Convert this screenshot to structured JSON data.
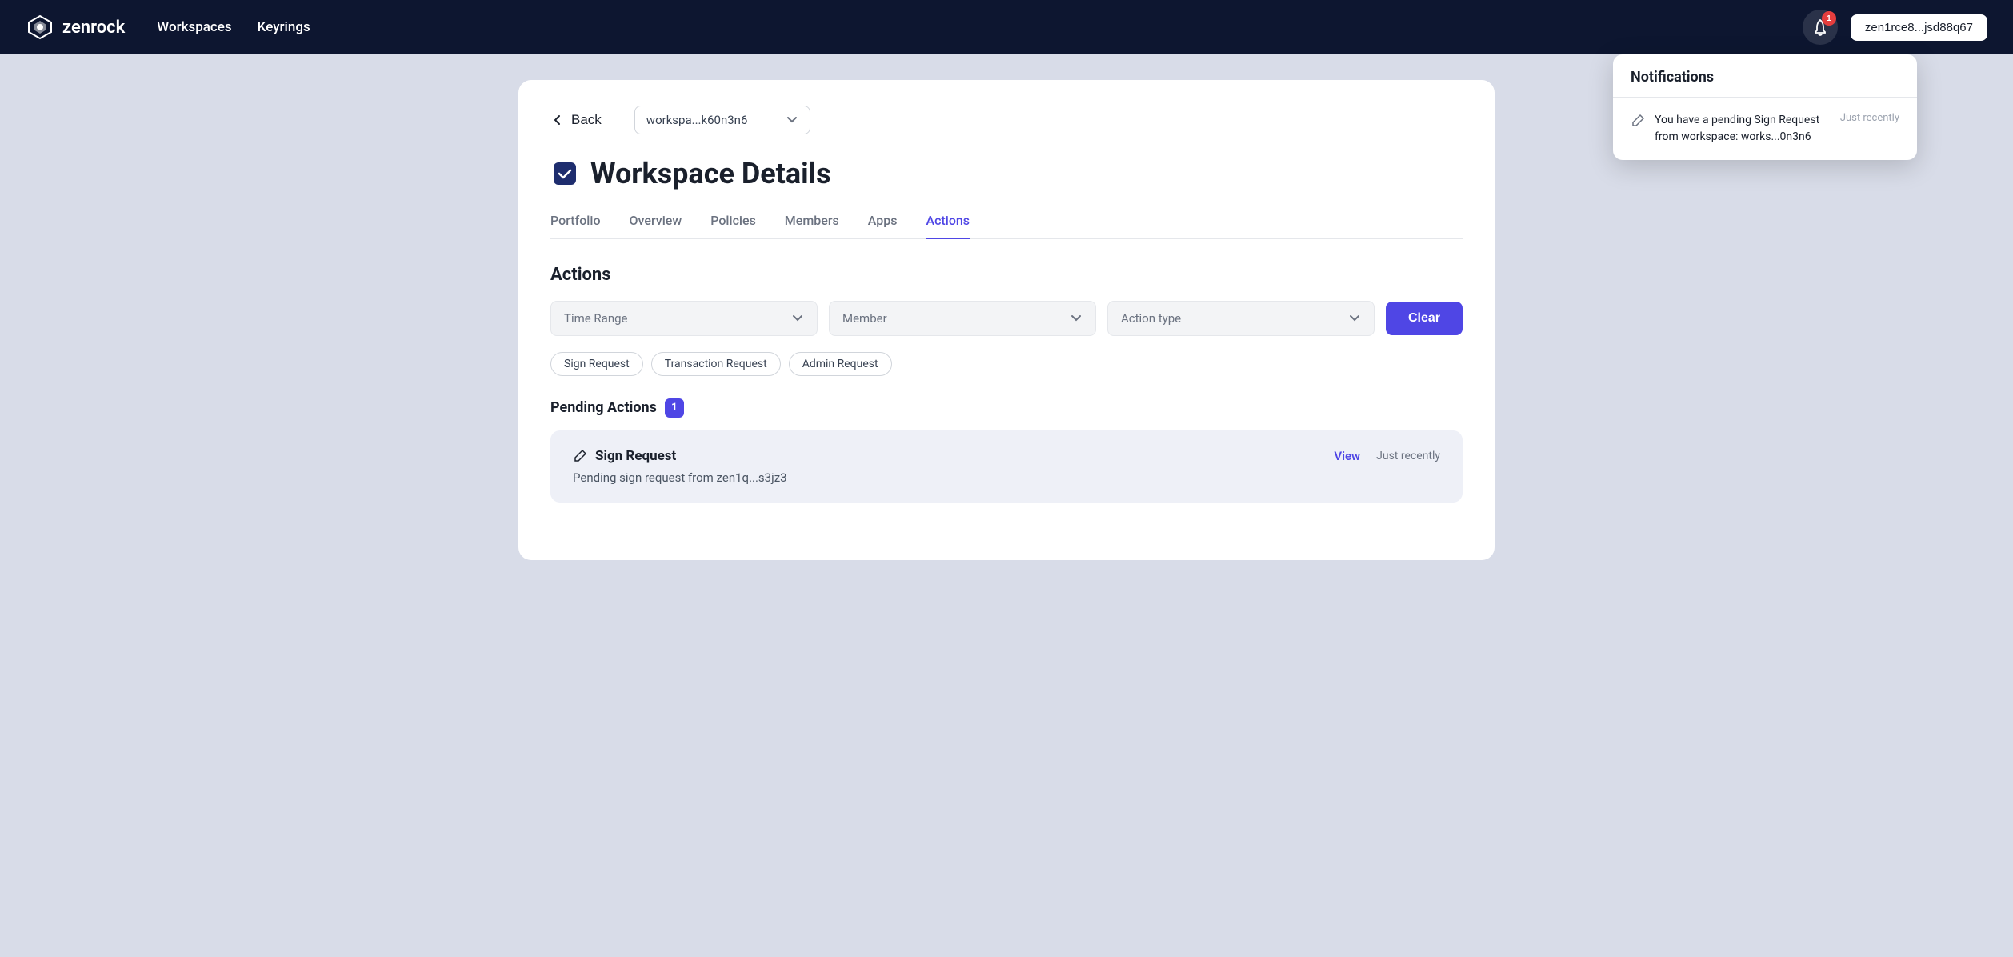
{
  "topnav": {
    "logo_text": "zenrock",
    "links": [
      "Workspaces",
      "Keyrings"
    ],
    "wallet_label": "zen1rce8...jsd88q67",
    "notif_count": "1"
  },
  "back_btn_label": "Back",
  "workspace_selector": {
    "value": "workspa...k60n3n6",
    "placeholder": "workspa...k60n3n6"
  },
  "page_title": "Workspace Details",
  "tabs": [
    {
      "label": "Portfolio",
      "active": false
    },
    {
      "label": "Overview",
      "active": false
    },
    {
      "label": "Policies",
      "active": false
    },
    {
      "label": "Members",
      "active": false
    },
    {
      "label": "Apps",
      "active": false
    },
    {
      "label": "Actions",
      "active": true
    }
  ],
  "section": {
    "title": "Actions"
  },
  "filters": {
    "time_range_label": "Time Range",
    "member_label": "Member",
    "action_type_label": "Action type",
    "clear_label": "Clear"
  },
  "chips": [
    {
      "label": "Sign Request"
    },
    {
      "label": "Transaction Request"
    },
    {
      "label": "Admin Request"
    }
  ],
  "pending": {
    "title": "Pending Actions",
    "count": "1",
    "items": [
      {
        "icon": "edit",
        "title": "Sign Request",
        "description": "Pending sign request from zen1q...s3jz3",
        "view_label": "View",
        "time": "Just recently"
      }
    ]
  },
  "notifications": {
    "title": "Notifications",
    "items": [
      {
        "icon": "edit",
        "text": "You have a pending Sign Request from workspace: works...0n3n6",
        "time": "Just recently"
      }
    ]
  }
}
